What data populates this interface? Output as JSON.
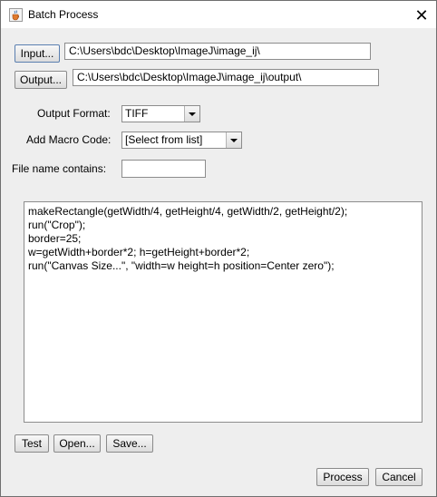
{
  "window": {
    "title": "Batch Process",
    "close_glyph": "✕"
  },
  "dirs": {
    "input_button": "Input...",
    "input_path": "C:\\Users\\bdc\\Desktop\\ImageJ\\image_ij\\",
    "output_button": "Output...",
    "output_path": "C:\\Users\\bdc\\Desktop\\ImageJ\\image_ij\\output\\"
  },
  "options": {
    "format_label": "Output Format:",
    "format_value": "TIFF",
    "macro_label": "Add Macro Code:",
    "macro_value": "[Select from list]",
    "filter_label": "File name contains:",
    "filter_value": ""
  },
  "macro": {
    "lines": [
      "makeRectangle(getWidth/4, getHeight/4, getWidth/2, getHeight/2);",
      "run(\"Crop\");",
      "border=25;",
      "w=getWidth+border*2; h=getHeight+border*2;",
      "run(\"Canvas Size...\", \"width=w height=h position=Center zero\");"
    ]
  },
  "buttons": {
    "test": "Test",
    "open": "Open...",
    "save": "Save...",
    "process": "Process",
    "cancel": "Cancel"
  },
  "icons": {
    "app": "java-coffee-cup-icon",
    "close": "close-icon"
  }
}
